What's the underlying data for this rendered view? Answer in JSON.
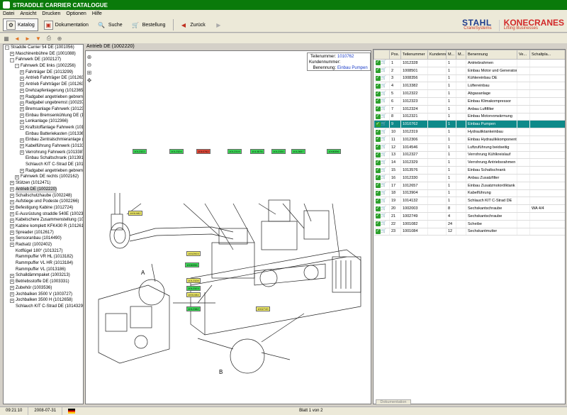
{
  "window": {
    "title": "STRADDLE CARRIER CATALOGUE"
  },
  "menu": [
    "Datei",
    "Ansicht",
    "Drucken",
    "Optionen",
    "Hilfe"
  ],
  "toolbar": {
    "katalog": "Katalog",
    "dokumentation": "Dokumentation",
    "suche": "Suche",
    "bestellung": "Bestellung",
    "zuruck": "Zurück"
  },
  "logos": {
    "stahl": "STAHL",
    "stahl_sub": "CraneSystems",
    "kone": "KONECRANES",
    "kone_sub": "Lifting Businesses"
  },
  "tree": [
    {
      "label": "Straddle Carrier 54 DE (1001056)",
      "indent": 0,
      "exp": "-"
    },
    {
      "label": "Maschinenbühne DE (1001088)",
      "indent": 1,
      "exp": "+"
    },
    {
      "label": "Fahrwerk DE (1002127)",
      "indent": 1,
      "exp": "-"
    },
    {
      "label": "Fahrwerk DE links (1002256)",
      "indent": 2,
      "exp": "-"
    },
    {
      "label": "Fahrträger DE (1013299)",
      "indent": 3,
      "exp": "+"
    },
    {
      "label": "Antrieb Fahrträger DE (1012631)",
      "indent": 3,
      "exp": "+"
    },
    {
      "label": "Antrieb Fahrträger DE (1012632)",
      "indent": 3,
      "exp": "+"
    },
    {
      "label": "Drehzapfenlagerung (1012365)",
      "indent": 3,
      "exp": "+"
    },
    {
      "label": "Radgabel angetrieben gebremst (",
      "indent": 3,
      "exp": "+"
    },
    {
      "label": "Radgabel ungebremst (1002377)",
      "indent": 3,
      "exp": "+"
    },
    {
      "label": "Bremsanlage Fahrwerk (1012367",
      "indent": 3,
      "exp": "+"
    },
    {
      "label": "Einbau Bremsenkühlung DE (1012",
      "indent": 3,
      "exp": "+"
    },
    {
      "label": "Lenkanlage (1012366)",
      "indent": 3,
      "exp": "+"
    },
    {
      "label": "Kraftstoffanlage Fahrwerk (1012",
      "indent": 3,
      "exp": "+"
    },
    {
      "label": "Einbau Batteriekasten (1013368)",
      "indent": 3,
      "exp": ""
    },
    {
      "label": "Einbau Zentralschmieranlage (101",
      "indent": 3,
      "exp": "+"
    },
    {
      "label": "Kabelführung Fahrwerk (1013386",
      "indent": 3,
      "exp": "+"
    },
    {
      "label": "Verrohrung Fahrwerk (1013387)",
      "indent": 3,
      "exp": "+"
    },
    {
      "label": "Einbau Schaltschrank (1013911)",
      "indent": 3,
      "exp": ""
    },
    {
      "label": "Schlauch KIT C-Strad DE (101484",
      "indent": 3,
      "exp": ""
    },
    {
      "label": "Radgabel angetrieben gebremst",
      "indent": 3,
      "exp": "+"
    },
    {
      "label": "Fahrwerk DE rechts (1002162)",
      "indent": 2,
      "exp": "+"
    },
    {
      "label": "Stützen (1012471)",
      "indent": 1,
      "exp": "+"
    },
    {
      "label": "Antrieb DE (1002220)",
      "indent": 1,
      "exp": "+",
      "selected": true
    },
    {
      "label": "Schallschutzhaube (1002248)",
      "indent": 1,
      "exp": "+"
    },
    {
      "label": "Aufstiege und Podeste (1002266)",
      "indent": 1,
      "exp": "+"
    },
    {
      "label": "Befestigung Kabine (1012724)",
      "indent": 1,
      "exp": "+"
    },
    {
      "label": "E-Ausrüstung straddle 540E (1002396)",
      "indent": 1,
      "exp": "+"
    },
    {
      "label": "Kabelschere Zusammenstellung (101309",
      "indent": 1,
      "exp": "+"
    },
    {
      "label": "Kabine komplett KFK430 R (1012618)",
      "indent": 1,
      "exp": "+"
    },
    {
      "label": "Spreader (1012617)",
      "indent": 1,
      "exp": "+"
    },
    {
      "label": "Sensoranbau (1014490)",
      "indent": 1,
      "exp": "+"
    },
    {
      "label": "Radsatz (1002402)",
      "indent": 1,
      "exp": "+"
    },
    {
      "label": "Kotflügel 180° (1013217)",
      "indent": 1,
      "exp": ""
    },
    {
      "label": "Rammpuffer VR HL (1013182)",
      "indent": 1,
      "exp": ""
    },
    {
      "label": "Rammpuffer VL HR (1013184)",
      "indent": 1,
      "exp": ""
    },
    {
      "label": "Rammpuffer VL (1013186)",
      "indent": 1,
      "exp": ""
    },
    {
      "label": "Schalldämmpaket (1003213)",
      "indent": 1,
      "exp": "+"
    },
    {
      "label": "Betriebsstoffe DE (1003331)",
      "indent": 1,
      "exp": "+"
    },
    {
      "label": "Zubehör (1003536)",
      "indent": 1,
      "exp": "+"
    },
    {
      "label": "Jochbalken 3500 V (1003727)",
      "indent": 1,
      "exp": "+"
    },
    {
      "label": "Jochbalken 3500 H (1012658)",
      "indent": 1,
      "exp": "+"
    },
    {
      "label": "Schlauch KIT C-Strad DE (1014329)",
      "indent": 1,
      "exp": ""
    }
  ],
  "center": {
    "header": "Antrieb DE (1002220)",
    "info": {
      "teilenummer_label": "Teilenummer:",
      "teilenummer": "1010762",
      "kundennummer_label": "Kundennummer:",
      "kundennummer": "",
      "benennung_label": "Benennung:",
      "benennung": "Einbau Pumpen"
    },
    "tags": [
      {
        "text": "1012322",
        "c": "g"
      },
      {
        "text": "1012324",
        "c": "g"
      },
      {
        "text": "1010762",
        "c": "r"
      },
      {
        "text": "1012319",
        "c": "g"
      },
      {
        "text": "1013576",
        "c": "g"
      },
      {
        "text": "1012330",
        "c": "g"
      },
      {
        "text": "1012657",
        "c": "g"
      },
      {
        "text": "1008356",
        "c": "g"
      },
      {
        "text": "1001082",
        "c": "y"
      },
      {
        "text": "1002003",
        "c": "y"
      },
      {
        "text": "1008356",
        "c": "g"
      },
      {
        "text": "1012328",
        "c": "y"
      },
      {
        "text": "1012323",
        "c": "g"
      },
      {
        "text": "1001084",
        "c": "y"
      },
      {
        "text": "1012382",
        "c": "g"
      },
      {
        "text": "1002749",
        "c": "y"
      }
    ],
    "labels": {
      "a": "A",
      "b": "B"
    }
  },
  "grid": {
    "columns": [
      "",
      "Pos.",
      "Teilenummer",
      "Kundennu...",
      "M...",
      "M...",
      "Benennung",
      "Ve...",
      "Schaltpla..."
    ],
    "rows": [
      [
        "1",
        "1012328",
        "",
        "1",
        "",
        "Antriebrahmen",
        "",
        ""
      ],
      [
        "2",
        "1008501",
        "",
        "1",
        "",
        "Einbau Motor und Generator",
        "",
        ""
      ],
      [
        "3",
        "1008356",
        "",
        "1",
        "",
        "Kühlereinbau DE",
        "",
        ""
      ],
      [
        "4",
        "1013382",
        "",
        "1",
        "",
        "Lüftereinbau",
        "",
        ""
      ],
      [
        "5",
        "1012322",
        "",
        "1",
        "",
        "Abgasanlage",
        "",
        ""
      ],
      [
        "6",
        "1012323",
        "",
        "1",
        "",
        "Einbau Klimakompressor",
        "",
        ""
      ],
      [
        "7",
        "1012324",
        "",
        "1",
        "",
        "Anbau Luftfilter",
        "",
        ""
      ],
      [
        "8",
        "1012321",
        "",
        "1",
        "",
        "Einbau Motorvorwärmung",
        "",
        ""
      ],
      [
        "9",
        "1010762",
        "",
        "1",
        "",
        "Einbau Pumpen",
        "",
        ""
      ],
      [
        "10",
        "1012319",
        "",
        "1",
        "",
        "Hydrauliktankeinbau",
        "",
        ""
      ],
      [
        "11",
        "1012306",
        "",
        "1",
        "",
        "Einbau Hydraulikkomponente",
        "",
        ""
      ],
      [
        "12",
        "1014546",
        "",
        "1",
        "",
        "Luftzuführung beidseitig",
        "",
        ""
      ],
      [
        "13",
        "1012327",
        "",
        "1",
        "",
        "Verrohrung Kühlkreislauf",
        "",
        ""
      ],
      [
        "14",
        "1012329",
        "",
        "1",
        "",
        "Verrohrung Antriebsrahmen",
        "",
        ""
      ],
      [
        "15",
        "1013576",
        "",
        "1",
        "",
        "Einbau Schaltschrank",
        "",
        ""
      ],
      [
        "16",
        "1012330",
        "",
        "1",
        "",
        "Anbau Zusatzfilter",
        "",
        ""
      ],
      [
        "17",
        "1012657",
        "",
        "1",
        "",
        "Einbau Zusatzmotorölktank",
        "",
        ""
      ],
      [
        "18",
        "1013904",
        "",
        "1",
        "",
        "Kabelführung",
        "",
        ""
      ],
      [
        "19",
        "1014132",
        "",
        "1",
        "",
        "Schlauch KIT C-Strad DE",
        "",
        ""
      ],
      [
        "20",
        "1002003",
        "",
        "8",
        "",
        "Sechskantschraube",
        "",
        "WA 4/4"
      ],
      [
        "21",
        "1002749",
        "",
        "4",
        "",
        "Sechskantschraube",
        "",
        ""
      ],
      [
        "22",
        "1001082",
        "",
        "24",
        "",
        "Scheibe",
        "",
        ""
      ],
      [
        "23",
        "1001084",
        "",
        "12",
        "",
        "Sechskantmutter",
        "",
        ""
      ]
    ],
    "selected_row": 8
  },
  "bottom_tab": "Dokumentation",
  "status": {
    "time": "09:21:10",
    "date": "2008-07-31",
    "page": "Blatt 1 von 2"
  }
}
